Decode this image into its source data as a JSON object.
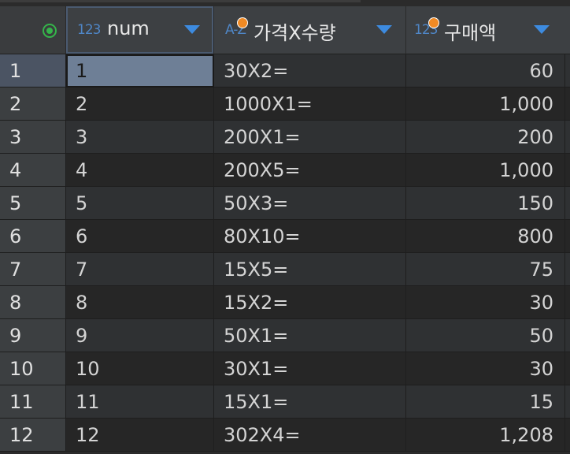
{
  "table": {
    "columns": [
      {
        "type_icon": "123",
        "name": "num",
        "has_key": false
      },
      {
        "type_icon": "A-Z",
        "name": "가격X수량",
        "has_key": true
      },
      {
        "type_icon": "123",
        "name": "구매액",
        "has_key": true
      }
    ],
    "rows": [
      {
        "index": "1",
        "num": "1",
        "expr": "30X2=",
        "amount": "60"
      },
      {
        "index": "2",
        "num": "2",
        "expr": "1000X1=",
        "amount": "1,000"
      },
      {
        "index": "3",
        "num": "3",
        "expr": "200X1=",
        "amount": "200"
      },
      {
        "index": "4",
        "num": "4",
        "expr": "200X5=",
        "amount": "1,000"
      },
      {
        "index": "5",
        "num": "5",
        "expr": "50X3=",
        "amount": "150"
      },
      {
        "index": "6",
        "num": "6",
        "expr": "80X10=",
        "amount": "800"
      },
      {
        "index": "7",
        "num": "7",
        "expr": "15X5=",
        "amount": "75"
      },
      {
        "index": "8",
        "num": "8",
        "expr": "15X2=",
        "amount": "30"
      },
      {
        "index": "9",
        "num": "9",
        "expr": "50X1=",
        "amount": "50"
      },
      {
        "index": "10",
        "num": "10",
        "expr": "30X1=",
        "amount": "30"
      },
      {
        "index": "11",
        "num": "11",
        "expr": "15X1=",
        "amount": "15"
      },
      {
        "index": "12",
        "num": "12",
        "expr": "302X4=",
        "amount": "1,208"
      }
    ],
    "selected_row": 0
  },
  "colors": {
    "accent_sort": "#3d8be0",
    "key_dot": "#f08a24",
    "selection_icon": "#35b44a",
    "selected_cell": "#6e7f96"
  },
  "icons": {
    "corner": "select-all-icon",
    "sort": "sort-dropdown-icon",
    "key": "key-dot-icon"
  }
}
